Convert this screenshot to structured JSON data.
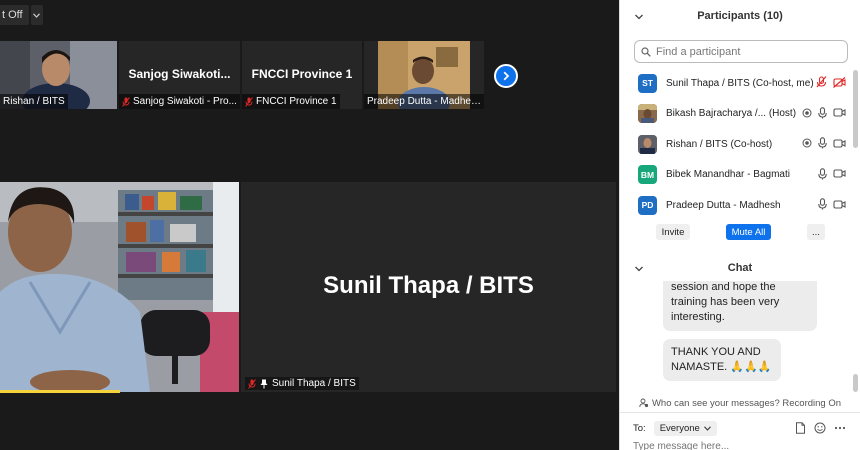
{
  "toolbar": {
    "view_toggle_label": "t Off"
  },
  "gallery": {
    "thumbnails": [
      {
        "name": "",
        "label": "Rishan / BITS",
        "muted": false
      },
      {
        "name": "Sanjog  Siwakoti...",
        "label": "Sanjog Siwakoti - Pro...",
        "muted": true
      },
      {
        "name": "FNCCI Province 1",
        "label": "FNCCI Province 1",
        "muted": true
      },
      {
        "name": "",
        "label": "Pradeep Dutta - Madhesh",
        "muted": false
      }
    ]
  },
  "active_speaker": {
    "big_name": "Sunil Thapa / BITS",
    "label": "Sunil Thapa / BITS"
  },
  "participants": {
    "title": "Participants (10)",
    "search_placeholder": "Find a participant",
    "items": [
      {
        "initials": "ST",
        "name": "Sunil Thapa / BITS (Co-host, me)",
        "color": "#1e6fc4"
      },
      {
        "initials": "",
        "name": "Bikash Bajracharya /...  (Host)",
        "color": "#7a5a3a"
      },
      {
        "initials": "",
        "name": "Rishan / BITS (Co-host)",
        "color": "#6a7b8e"
      },
      {
        "initials": "BM",
        "name": "Bibek Manandhar - Bagmati",
        "color": "#17a77a"
      },
      {
        "initials": "PD",
        "name": "Pradeep Dutta - Madhesh",
        "color": "#1e6fc4"
      }
    ],
    "invite_label": "Invite",
    "mute_all_label": "Mute All",
    "more_label": "..."
  },
  "chat": {
    "title": "Chat",
    "messages": [
      {
        "text": "session and hope the training has been very interesting."
      },
      {
        "text": "THANK YOU AND NAMASTE.",
        "emoji": "🙏🙏🙏"
      }
    ],
    "privacy_notice": "Who can see your messages? Recording On",
    "to_label": "To:",
    "recipient": "Everyone",
    "input_placeholder": "Type message here..."
  },
  "colors": {
    "accent": "#0e72ed",
    "muted_red": "#e02828",
    "speaker_highlight": "#f5d33b"
  }
}
